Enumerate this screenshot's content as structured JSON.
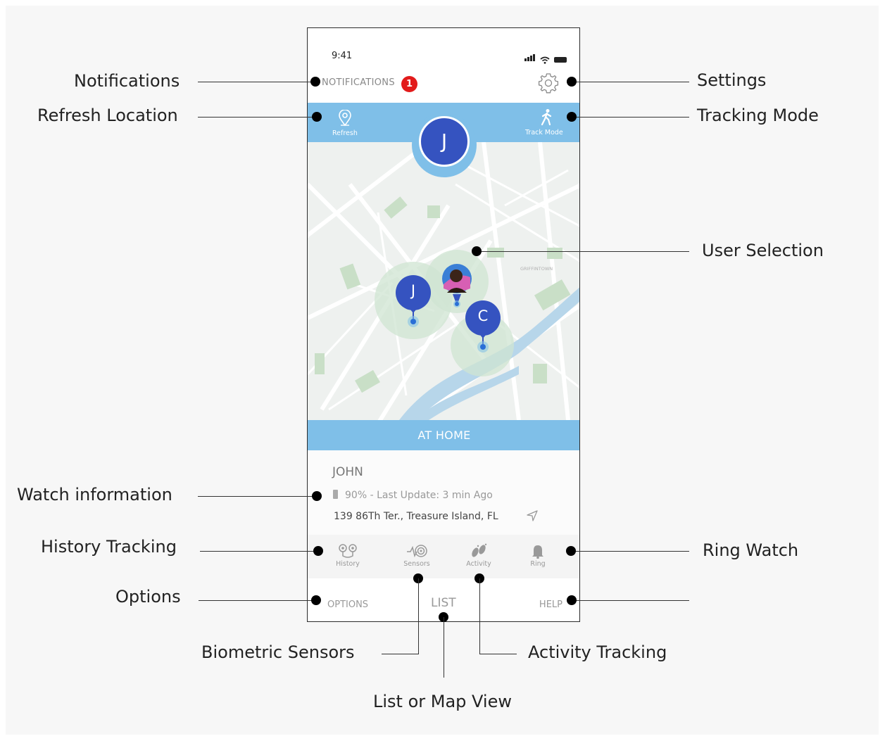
{
  "status": {
    "time": "9:41"
  },
  "header": {
    "notifications_label": "NOTIFICATIONS",
    "notifications_count": "1"
  },
  "topbar": {
    "refresh_label": "Refresh",
    "track_label": "Track Mode"
  },
  "selected_user": {
    "initial": "J"
  },
  "map": {
    "pins": [
      {
        "initial": "J",
        "color": "#3553c0"
      },
      {
        "initial": "C",
        "color": "#3553c0"
      }
    ],
    "labels": [
      "GRIFFINTOWN"
    ]
  },
  "status_bar": {
    "label": "AT HOME"
  },
  "watch": {
    "name": "JOHN",
    "status": "90% - Last Update: 3 min Ago",
    "address": "139 86Th Ter., Treasure Island, FL"
  },
  "tabs": [
    {
      "label": "History"
    },
    {
      "label": "Sensors"
    },
    {
      "label": "Activity"
    },
    {
      "label": "Ring"
    }
  ],
  "bottom": {
    "options_label": "OPTIONS",
    "view_label": "LIST",
    "help_label": "HELP"
  },
  "annotations": {
    "notifications": "Notifications",
    "refresh_location": "Refresh Location",
    "settings": "Settings",
    "tracking_mode": "Tracking Mode",
    "user_selection": "User Selection",
    "watch_information": "Watch information",
    "history_tracking": "History Tracking",
    "ring_watch": "Ring Watch",
    "options": "Options",
    "biometric_sensors": "Biometric Sensors",
    "activity_tracking": "Activity Tracking",
    "list_or_map_view": "List or Map View"
  },
  "colors": {
    "accent": "#7fbfe8",
    "pin": "#3553c0",
    "badge": "#e21b1b"
  }
}
